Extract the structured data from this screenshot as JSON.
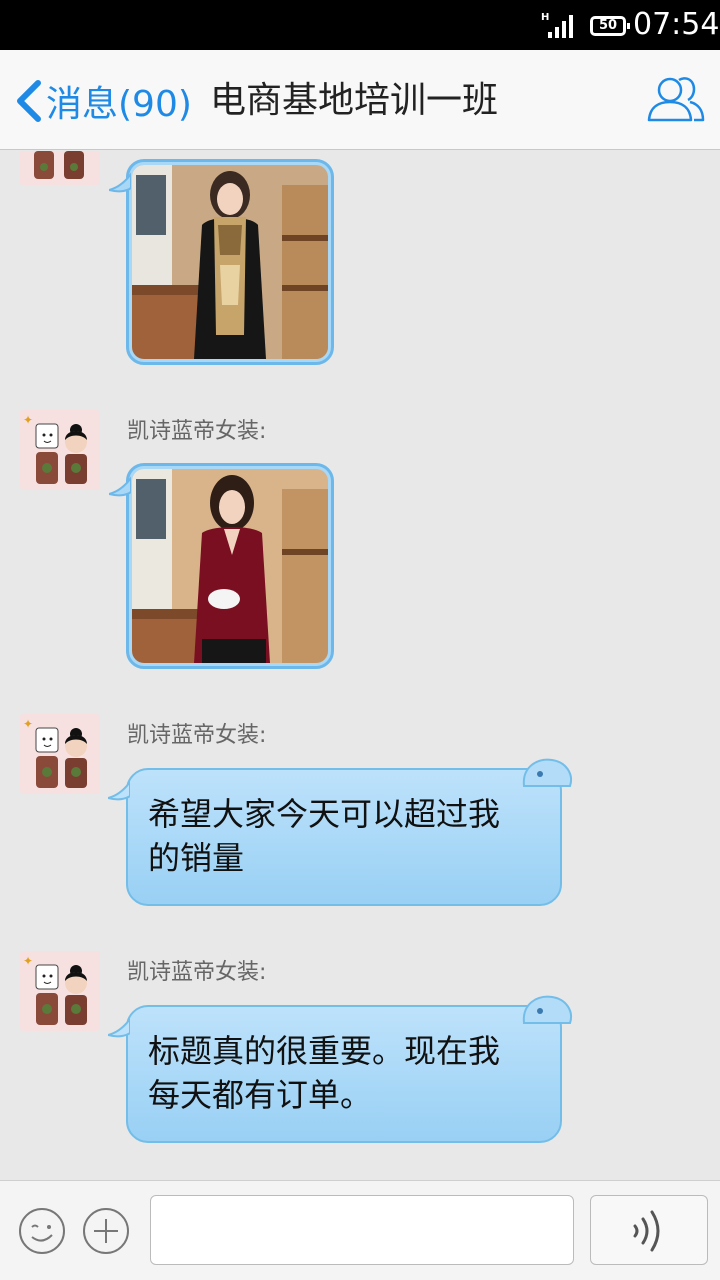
{
  "status_bar": {
    "network": "H",
    "battery": "50",
    "time": "07:54"
  },
  "header": {
    "back_label": "消息(90)",
    "title": "电商基地培训一班"
  },
  "messages": [
    {
      "type": "image",
      "sender": "",
      "image": "woman-scarf-photo"
    },
    {
      "type": "image",
      "sender": "凯诗蓝帝女装:",
      "image": "woman-burgundy-top-photo"
    },
    {
      "type": "text",
      "sender": "凯诗蓝帝女装:",
      "text_line1": "希望大家今天可以超过我",
      "text_line2": "的销量"
    },
    {
      "type": "text",
      "sender": "凯诗蓝帝女装:",
      "text_line1": "标题真的很重要。现在我",
      "text_line2": "每天都有订单。"
    }
  ],
  "input": {
    "placeholder": "",
    "value": ""
  },
  "colors": {
    "accent": "#1e8ae6",
    "bubble": "#a9d7f6",
    "bubble_border": "#73bde9"
  }
}
